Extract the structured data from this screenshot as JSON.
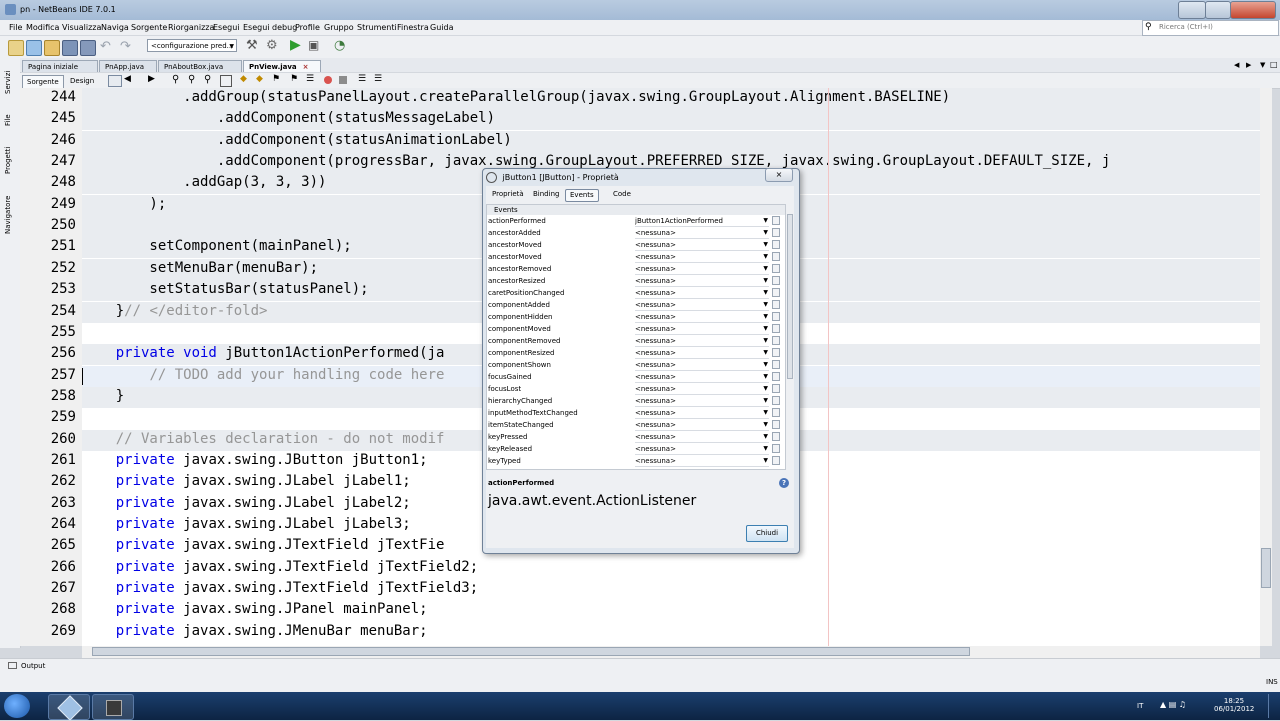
{
  "window": {
    "title": "pn - NetBeans IDE 7.0.1"
  },
  "menu": [
    "File",
    "Modifica",
    "Visualizza",
    "Naviga",
    "Sorgente",
    "Riorganizza",
    "Esegui",
    "Esegui debug",
    "Profile",
    "Gruppo",
    "Strumenti",
    "Finestra",
    "Guida"
  ],
  "search": {
    "placeholder": "Ricerca (Ctrl+I)"
  },
  "toolbar": {
    "config": "<configurazione pred..."
  },
  "sidebar": {
    "tabs": [
      "Servizi",
      "File",
      "Progetti",
      "Navigatore"
    ]
  },
  "editor_tabs": [
    "Pagina iniziale",
    "PnApp.java",
    "PnAboutBox.java",
    "PnView.java"
  ],
  "editor_mode": {
    "source": "Sorgente",
    "design": "Design"
  },
  "code": {
    "lines": [
      {
        "n": "244",
        "fold": true,
        "segs": [
          {
            "t": "            .addGroup(statusPanelLayout.createParallelGroup(javax.swing.GroupLayout.Alignment.BASELINE)",
            "c": ""
          }
        ]
      },
      {
        "n": "245",
        "fold": true,
        "segs": [
          {
            "t": "                .addComponent(statusMessageLabel)",
            "c": ""
          }
        ]
      },
      {
        "n": "246",
        "fold": true,
        "segs": [
          {
            "t": "                .addComponent(statusAnimationLabel)",
            "c": ""
          }
        ]
      },
      {
        "n": "247",
        "fold": true,
        "segs": [
          {
            "t": "                .addComponent(progressBar, javax.swing.GroupLayout.PREFERRED_SIZE, javax.swing.GroupLayout.DEFAULT_SIZE, j",
            "c": ""
          }
        ]
      },
      {
        "n": "248",
        "fold": true,
        "segs": [
          {
            "t": "            .addGap(3, 3, 3))",
            "c": ""
          }
        ]
      },
      {
        "n": "249",
        "fold": true,
        "segs": [
          {
            "t": "        );",
            "c": ""
          }
        ]
      },
      {
        "n": "250",
        "fold": true,
        "segs": [
          {
            "t": "",
            "c": ""
          }
        ]
      },
      {
        "n": "251",
        "fold": true,
        "segs": [
          {
            "t": "        setComponent(mainPanel);",
            "c": ""
          }
        ]
      },
      {
        "n": "252",
        "fold": true,
        "segs": [
          {
            "t": "        setMenuBar(menuBar);",
            "c": ""
          }
        ]
      },
      {
        "n": "253",
        "fold": true,
        "segs": [
          {
            "t": "        setStatusBar(statusPanel);",
            "c": ""
          }
        ]
      },
      {
        "n": "254",
        "fold": true,
        "segs": [
          {
            "t": "    }",
            "c": ""
          },
          {
            "t": "// </editor-fold>",
            "c": "cm"
          }
        ]
      },
      {
        "n": "255",
        "fold": false,
        "segs": [
          {
            "t": "",
            "c": ""
          }
        ]
      },
      {
        "n": "256",
        "fold": true,
        "segs": [
          {
            "t": "    ",
            "c": ""
          },
          {
            "t": "private void",
            "c": "kw"
          },
          {
            "t": " jButton1ActionPerformed(ja",
            "c": ""
          }
        ]
      },
      {
        "n": "257",
        "fold": false,
        "cur": true,
        "segs": [
          {
            "t": "        ",
            "c": ""
          },
          {
            "t": "// TODO add your handling code here",
            "c": "cm"
          }
        ]
      },
      {
        "n": "258",
        "fold": true,
        "segs": [
          {
            "t": "    }",
            "c": ""
          }
        ]
      },
      {
        "n": "259",
        "fold": false,
        "segs": [
          {
            "t": "",
            "c": ""
          }
        ]
      },
      {
        "n": "260",
        "fold": true,
        "segs": [
          {
            "t": "    ",
            "c": ""
          },
          {
            "t": "// Variables declaration - do not modif",
            "c": "cm"
          }
        ]
      },
      {
        "n": "261",
        "fold": false,
        "segs": [
          {
            "t": "    ",
            "c": ""
          },
          {
            "t": "private",
            "c": "kw"
          },
          {
            "t": " javax.swing.JButton jButton1;",
            "c": ""
          }
        ]
      },
      {
        "n": "262",
        "fold": false,
        "segs": [
          {
            "t": "    ",
            "c": ""
          },
          {
            "t": "private",
            "c": "kw"
          },
          {
            "t": " javax.swing.JLabel jLabel1;",
            "c": ""
          }
        ]
      },
      {
        "n": "263",
        "fold": false,
        "segs": [
          {
            "t": "    ",
            "c": ""
          },
          {
            "t": "private",
            "c": "kw"
          },
          {
            "t": " javax.swing.JLabel jLabel2;",
            "c": ""
          }
        ]
      },
      {
        "n": "264",
        "fold": false,
        "segs": [
          {
            "t": "    ",
            "c": ""
          },
          {
            "t": "private",
            "c": "kw"
          },
          {
            "t": " javax.swing.JLabel jLabel3;",
            "c": ""
          }
        ]
      },
      {
        "n": "265",
        "fold": false,
        "segs": [
          {
            "t": "    ",
            "c": ""
          },
          {
            "t": "private",
            "c": "kw"
          },
          {
            "t": " javax.swing.JTextField jTextFie",
            "c": ""
          }
        ]
      },
      {
        "n": "266",
        "fold": false,
        "segs": [
          {
            "t": "    ",
            "c": ""
          },
          {
            "t": "private",
            "c": "kw"
          },
          {
            "t": " javax.swing.JTextField jTextField2;",
            "c": ""
          }
        ]
      },
      {
        "n": "267",
        "fold": false,
        "segs": [
          {
            "t": "    ",
            "c": ""
          },
          {
            "t": "private",
            "c": "kw"
          },
          {
            "t": " javax.swing.JTextField jTextField3;",
            "c": ""
          }
        ]
      },
      {
        "n": "268",
        "fold": false,
        "segs": [
          {
            "t": "    ",
            "c": ""
          },
          {
            "t": "private",
            "c": "kw"
          },
          {
            "t": " javax.swing.JPanel mainPanel;",
            "c": ""
          }
        ]
      },
      {
        "n": "269",
        "fold": false,
        "segs": [
          {
            "t": "    ",
            "c": ""
          },
          {
            "t": "private",
            "c": "kw"
          },
          {
            "t": " javax.swing.JMenuBar menuBar;",
            "c": ""
          }
        ]
      }
    ]
  },
  "dialog": {
    "title": "jButton1 [JButton] - Proprietà",
    "tabs": [
      "Proprietà",
      "Binding",
      "Events",
      "Code"
    ],
    "active_tab": "Events",
    "section": "Events",
    "rows": [
      {
        "name": "actionPerformed",
        "value": "jButton1ActionPerformed"
      },
      {
        "name": "ancestorAdded",
        "value": "<nessuna>"
      },
      {
        "name": "ancestorMoved",
        "value": "<nessuna>"
      },
      {
        "name": "ancestorMoved",
        "value": "<nessuna>"
      },
      {
        "name": "ancestorRemoved",
        "value": "<nessuna>"
      },
      {
        "name": "ancestorResized",
        "value": "<nessuna>"
      },
      {
        "name": "caretPositionChanged",
        "value": "<nessuna>"
      },
      {
        "name": "componentAdded",
        "value": "<nessuna>"
      },
      {
        "name": "componentHidden",
        "value": "<nessuna>"
      },
      {
        "name": "componentMoved",
        "value": "<nessuna>"
      },
      {
        "name": "componentRemoved",
        "value": "<nessuna>"
      },
      {
        "name": "componentResized",
        "value": "<nessuna>"
      },
      {
        "name": "componentShown",
        "value": "<nessuna>"
      },
      {
        "name": "focusGained",
        "value": "<nessuna>"
      },
      {
        "name": "focusLost",
        "value": "<nessuna>"
      },
      {
        "name": "hierarchyChanged",
        "value": "<nessuna>"
      },
      {
        "name": "inputMethodTextChanged",
        "value": "<nessuna>"
      },
      {
        "name": "itemStateChanged",
        "value": "<nessuna>"
      },
      {
        "name": "keyPressed",
        "value": "<nessuna>"
      },
      {
        "name": "keyReleased",
        "value": "<nessuna>"
      },
      {
        "name": "keyTyped",
        "value": "<nessuna>"
      }
    ],
    "desc_name": "actionPerformed",
    "desc_value": "java.awt.event.ActionListener",
    "close_label": "Chiudi"
  },
  "output": {
    "label": "Output"
  },
  "status": {
    "mode": "INS"
  },
  "taskbar": {
    "lang": "IT",
    "time": "18:25",
    "date": "06/01/2012"
  },
  "colors": {
    "keyword": "#0000e6",
    "comment": "#969696",
    "fold_bg": "#e9ecf0"
  }
}
